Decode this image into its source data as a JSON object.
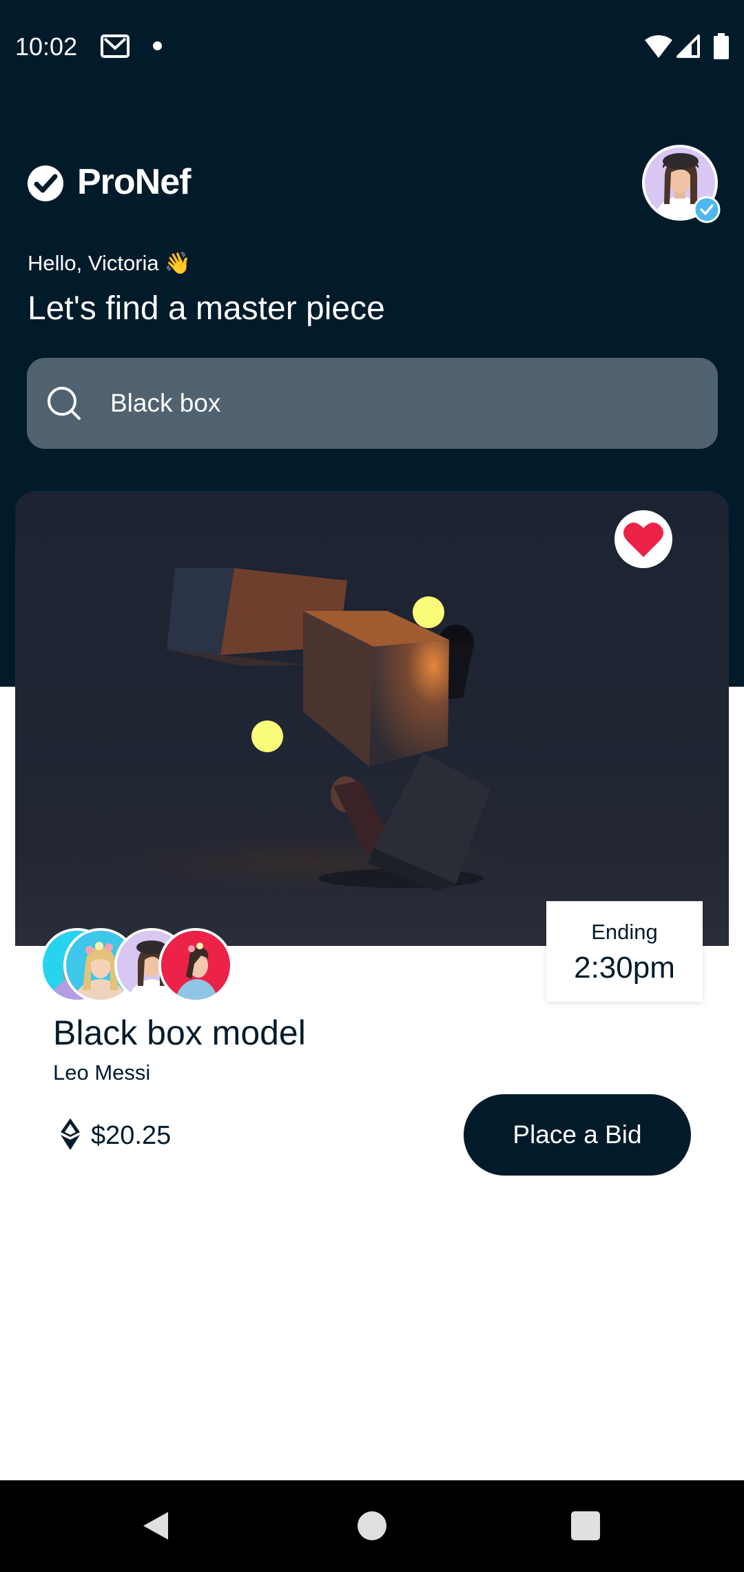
{
  "status_bar": {
    "time": "10:02",
    "icons": [
      "mail-icon",
      "notification-dot",
      "wifi-icon",
      "signal-icon",
      "battery-icon"
    ]
  },
  "app": {
    "brand": "ProNef",
    "greeting": "Hello, Victoria",
    "greeting_emoji": "👋",
    "headline": "Let's find a master piece"
  },
  "search": {
    "value": "Black box",
    "icon": "search-icon"
  },
  "card": {
    "favorited": true,
    "ending_label": "Ending",
    "ending_time": "2:30pm",
    "title": "Black box model",
    "artist": "Leo Messi",
    "price": "$20.25",
    "currency_icon": "ethereum-icon",
    "bid_button": "Place a Bid",
    "bidder_count": 4
  },
  "nav": {
    "icons": [
      "back-icon",
      "home-icon",
      "recents-icon"
    ]
  },
  "colors": {
    "primary": "#021b2b",
    "search_bg": "#50626f",
    "heart": "#ec2249",
    "verified": "#4fb8f0",
    "accent_dot": "#fbfb7a"
  }
}
